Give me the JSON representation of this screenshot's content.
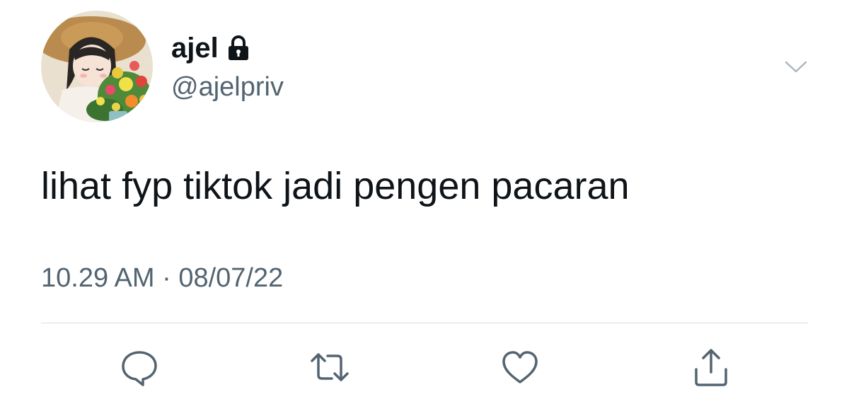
{
  "tweet": {
    "display_name": "ajel",
    "handle": "@ajelpriv",
    "text": "lihat fyp tiktok jadi pengen pacaran",
    "time": "10.29 AM",
    "separator": " · ",
    "date": "08/07/22",
    "protected": true
  },
  "icons": {
    "lock": "lock-icon",
    "more": "chevron-down-icon",
    "reply": "reply-icon",
    "retweet": "retweet-icon",
    "like": "heart-icon",
    "share": "share-icon"
  },
  "colors": {
    "text_primary": "#0f1419",
    "text_secondary": "#536471",
    "icon": "#536471",
    "divider": "#dcdcdc"
  }
}
